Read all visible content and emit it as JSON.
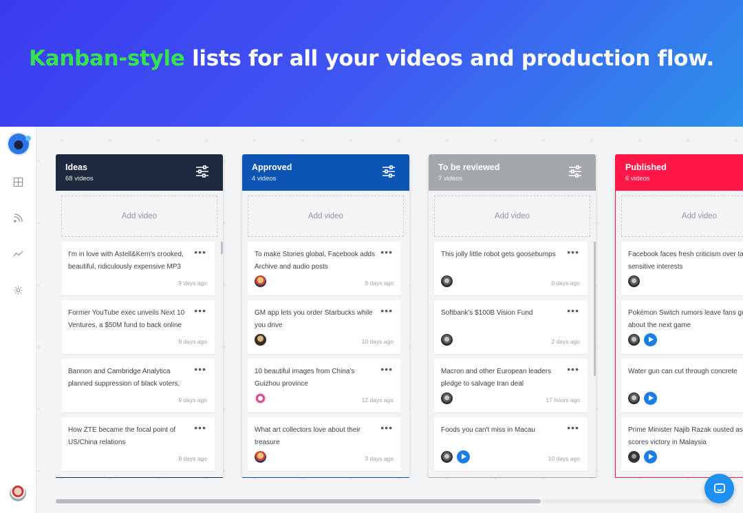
{
  "hero": {
    "accent": "Kanban-style",
    "rest": " lists for all your videos and production flow."
  },
  "colors": {
    "ideas": "#1d2a3d",
    "approved": "#0d55b5",
    "review": "#a4a7ab",
    "published": "#ff1848",
    "accent_green": "#35e34f"
  },
  "sidebar": {
    "icons": [
      "dashboard-grid-icon",
      "rss-feed-icon",
      "analytics-icon",
      "settings-gear-icon"
    ]
  },
  "add_video_label": "Add video",
  "columns": [
    {
      "title": "Ideas",
      "count": "68 videos",
      "cards": [
        {
          "title": "I'm in love with Astell&Kern's crooked, beautiful, ridiculously expensive MP3",
          "time": "9 days ago"
        },
        {
          "title": "Former YouTube exec unveils Next 10 Ventures, a $50M fund to back online",
          "time": "9 days ago"
        },
        {
          "title": "Bannon and Cambridge Analytica planned suppression of black voters,",
          "time": "9 days ago"
        },
        {
          "title": "How ZTE became the focal point of US/China relations",
          "time": "9 days ago"
        }
      ]
    },
    {
      "title": "Approved",
      "count": "4 videos",
      "cards": [
        {
          "title": "To make Stories global, Facebook adds Archive and audio posts",
          "time": "9 days ago"
        },
        {
          "title": "GM app lets you order Starbucks while you drive",
          "time": "10 days ago"
        },
        {
          "title": "10 beautiful images from China's Guizhou province",
          "time": "12 days ago"
        },
        {
          "title": "What art collectors love about their treasure",
          "time": "3 days ago"
        }
      ]
    },
    {
      "title": "To be reviewed",
      "count": "7 videos",
      "cards": [
        {
          "title": "This jolly little robot gets goosebumps",
          "time": "9 days ago"
        },
        {
          "title": "Softbank's $100B Vision Fund",
          "time": "2 days ago"
        },
        {
          "title": "Macron and other European leaders pledge to salvage Iran deal",
          "time": "17 hours ago"
        },
        {
          "title": "Foods you can't miss in Macau",
          "time": "10 days ago"
        }
      ]
    },
    {
      "title": "Published",
      "count": "6 videos",
      "cards": [
        {
          "title": "Facebook faces fresh criticism over targeting of sensitive interests",
          "time": ""
        },
        {
          "title": "Pokémon Switch rumors leave fans guessing about the next game",
          "time": ""
        },
        {
          "title": "Water gun can cut through concrete",
          "time": ""
        },
        {
          "title": "Prime Minister Najib Razak ousted as opposition scores victory in Malaysia",
          "time": ""
        }
      ]
    }
  ]
}
